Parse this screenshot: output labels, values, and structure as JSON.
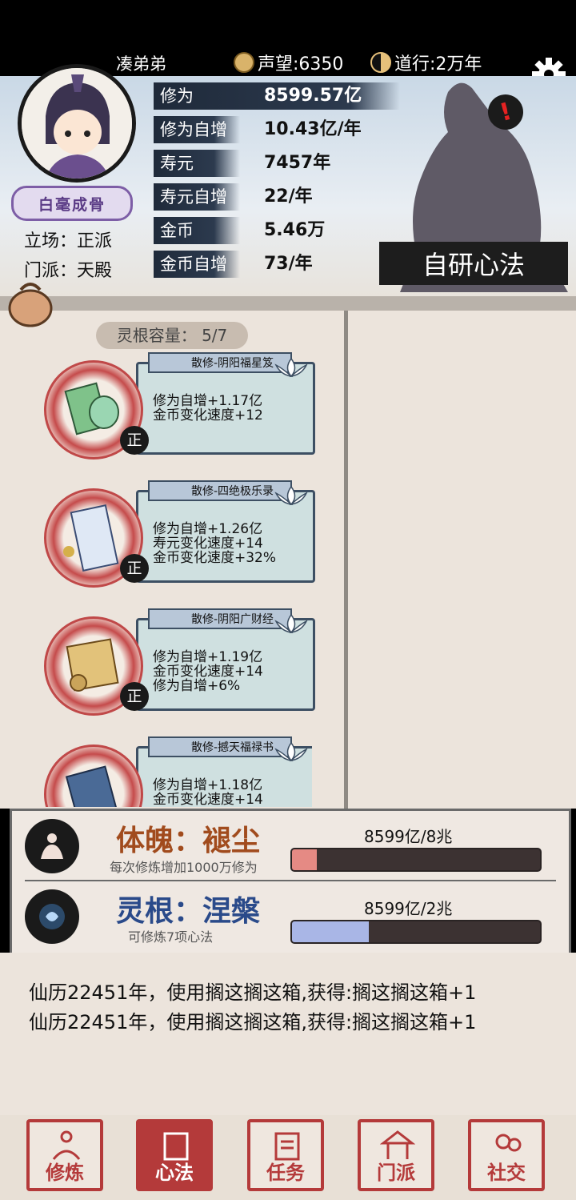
{
  "top_bar": {
    "player_name": "凑弟弟",
    "reputation": "声望:6350",
    "dao": "道行:2万年"
  },
  "profile": {
    "title_badge": "白毫成骨",
    "stance": "立场：正派",
    "sect": "门派：天殿"
  },
  "stats": [
    {
      "label": "修为",
      "value": "8599.57亿"
    },
    {
      "label": "修为自增",
      "value": "10.43亿/年"
    },
    {
      "label": "寿元",
      "value": "7457年"
    },
    {
      "label": "寿元自增",
      "value": "22/年"
    },
    {
      "label": "金币",
      "value": "5.46万"
    },
    {
      "label": "金币自增",
      "value": "73/年"
    }
  ],
  "research_button": "自研心法",
  "capacity": "灵根容量： 5/7",
  "cards": [
    {
      "title": "散修-阴阳福星笈",
      "effects": [
        "修为自增+1.17亿",
        "金币变化速度+12"
      ],
      "badge": "正"
    },
    {
      "title": "散修-四绝极乐录",
      "effects": [
        "修为自增+1.26亿",
        "寿元变化速度+14",
        "金币变化速度+32%"
      ],
      "badge": "正"
    },
    {
      "title": "散修-阴阳广财经",
      "effects": [
        "修为自增+1.19亿",
        "金币变化速度+14",
        "修为自增+6%"
      ],
      "badge": "正"
    },
    {
      "title": "散修-撼天福禄书",
      "effects": [
        "修为自增+1.18亿",
        "金币变化速度+14"
      ],
      "badge": ""
    }
  ],
  "body_stat": {
    "name": "体魄：褪尘",
    "sub": "每次修炼增加1000万修为",
    "progress_text": "8599亿/8兆",
    "progress": 0.1,
    "color": "#e58a84"
  },
  "root_stat": {
    "name": "灵根：涅槃",
    "sub": "可修炼7项心法",
    "progress_text": "8599亿/2兆",
    "progress": 0.31,
    "color": "#a9b6e6"
  },
  "log": [
    "仙历22451年，使用搁这搁这箱,获得:搁这搁这箱+1",
    "仙历22451年，使用搁这搁这箱,获得:搁这搁这箱+1"
  ],
  "nav": [
    {
      "label": "修炼",
      "icon": "meditate-icon"
    },
    {
      "label": "心法",
      "icon": "scroll-icon"
    },
    {
      "label": "任务",
      "icon": "task-icon"
    },
    {
      "label": "门派",
      "icon": "sect-icon"
    },
    {
      "label": "社交",
      "icon": "social-icon"
    }
  ]
}
